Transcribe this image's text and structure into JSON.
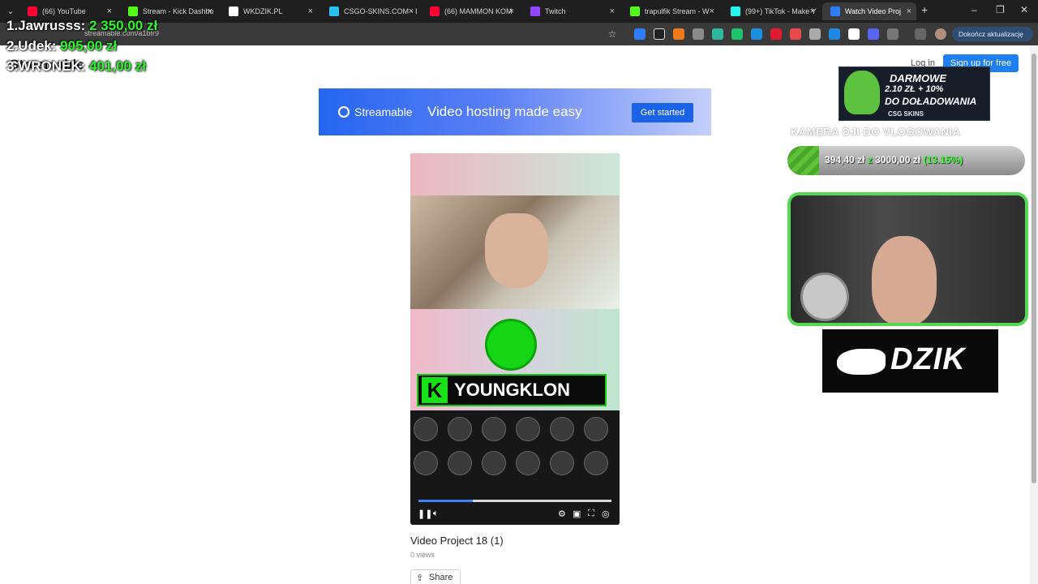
{
  "browser": {
    "tabs": [
      {
        "title": "(66) YouTube",
        "fav_color": "#ff0033"
      },
      {
        "title": "Stream - Kick Dashbo",
        "fav_color": "#53fc18"
      },
      {
        "title": "WKDZIK.PL",
        "fav_color": "#ffffff"
      },
      {
        "title": "CSGO-SKINS.COM - I",
        "fav_color": "#29c1f0"
      },
      {
        "title": "(66) MAMMON KOM",
        "fav_color": "#ff0033"
      },
      {
        "title": "Twitch",
        "fav_color": "#9146ff"
      },
      {
        "title": "trapulfik Stream - W",
        "fav_color": "#53fc18"
      },
      {
        "title": "(99+) TikTok - Make Y",
        "fav_color": "#25f4ee"
      },
      {
        "title": "Watch Video Proj",
        "fav_color": "#2f7df6"
      }
    ],
    "url": "streamable.com/a1bfr9",
    "update_button": "Dokończ aktualizację"
  },
  "site": {
    "logo": "Streamable",
    "login": "Log in",
    "signup": "Sign up for free"
  },
  "banner": {
    "logo": "Streamable",
    "tagline": "Video hosting made easy",
    "cta": "Get started"
  },
  "player": {
    "channel_name": "YOUNGKLON",
    "progress": 0.28
  },
  "video": {
    "title": "Video Project 18 (1)",
    "views": "0 views",
    "share": "Share"
  },
  "overlay": {
    "donors": [
      {
        "rank": "1.Jawrusss:",
        "amount": "2 350,00 zł"
      },
      {
        "rank": "2.Udek:",
        "amount": "905,00 zł"
      },
      {
        "rank": "3.WRONEK:",
        "amount": "401,00 zł"
      }
    ],
    "ad": {
      "line1": "DARMOWE",
      "line2": "2.10 ZŁ + 10%",
      "line3": "DO DOŁADOWANIA",
      "brand": "CSG SKINS"
    },
    "goal": {
      "title": "KAMERA DJI DO VLOGOWANIA",
      "current": "394,40 zł",
      "sep": "z",
      "target": "3000,00 zł",
      "percent": "(13.15%)",
      "fraction": 0.1315
    },
    "sponsor": "DZIK"
  }
}
